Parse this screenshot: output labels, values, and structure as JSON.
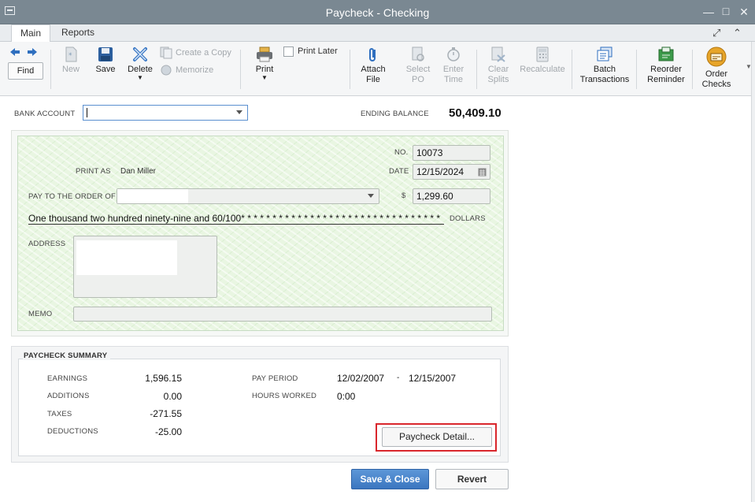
{
  "window": {
    "title": "Paycheck - Checking"
  },
  "tabs": [
    {
      "label": "Main",
      "active": true
    },
    {
      "label": "Reports",
      "active": false
    }
  ],
  "toolbar": {
    "find": "Find",
    "new": "New",
    "save": "Save",
    "delete": "Delete",
    "create_copy": "Create a Copy",
    "memorize": "Memorize",
    "print": "Print",
    "print_later": "Print Later",
    "attach_file": [
      "Attach",
      "File"
    ],
    "select_po": [
      "Select",
      "PO"
    ],
    "enter_time": [
      "Enter",
      "Time"
    ],
    "clear_splits": [
      "Clear",
      "Splits"
    ],
    "recalculate": "Recalculate",
    "batch_transactions": [
      "Batch",
      "Transactions"
    ],
    "reorder_reminder": [
      "Reorder",
      "Reminder"
    ],
    "order_checks": [
      "Order",
      "Checks"
    ]
  },
  "header": {
    "bank_account_label": "BANK ACCOUNT",
    "bank_account_value": "",
    "ending_balance_label": "ENDING BALANCE",
    "ending_balance_value": "50,409.10"
  },
  "check": {
    "no_label": "NO.",
    "no_value": "10073",
    "date_label": "DATE",
    "date_value": "12/15/2024",
    "print_as_label": "PRINT AS",
    "print_as_value": "Dan Miller",
    "pay_to_label": "PAY TO THE ORDER OF",
    "pay_to_value": "",
    "currency_symbol": "$",
    "amount_value": "1,299.60",
    "amount_words": "One thousand two hundred ninety-nine and 60/100* * * * * * * * * * * * * * * * * * * * * * * * * * * * * * * *",
    "dollars_label": "DOLLARS",
    "address_label": "ADDRESS",
    "memo_label": "MEMO",
    "memo_value": ""
  },
  "summary": {
    "title": "PAYCHECK SUMMARY",
    "earnings_label": "EARNINGS",
    "earnings_value": "1,596.15",
    "additions_label": "ADDITIONS",
    "additions_value": "0.00",
    "taxes_label": "TAXES",
    "taxes_value": "-271.55",
    "deductions_label": "DEDUCTIONS",
    "deductions_value": "-25.00",
    "pay_period_label": "PAY PERIOD",
    "pay_period_start": "12/02/2007",
    "pay_period_sep": "-",
    "pay_period_end": "12/15/2007",
    "hours_worked_label": "HOURS WORKED",
    "hours_worked_value": "0:00",
    "detail_button": "Paycheck Detail..."
  },
  "footer": {
    "save_close": "Save & Close",
    "revert": "Revert"
  },
  "colors": {
    "accent": "#3b76c0",
    "highlight": "#d9262c",
    "check_bg": "#e9f6e2",
    "titlebar": "#7a8892"
  }
}
